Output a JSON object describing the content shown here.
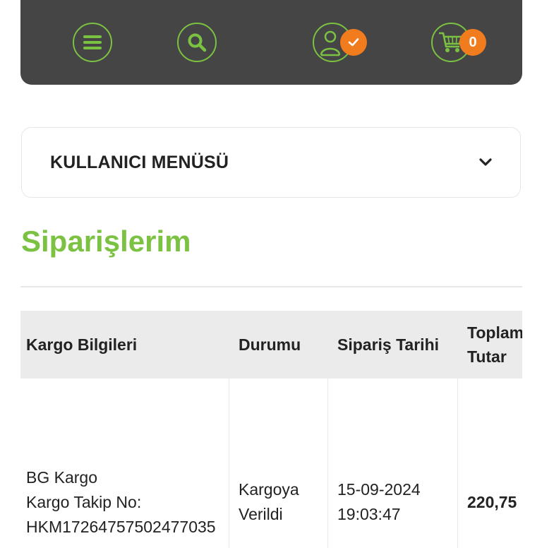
{
  "header": {
    "icons": [
      "menu-icon",
      "search-icon",
      "user-icon",
      "cart-icon"
    ],
    "user_badge_icon": "check-icon",
    "cart_count": "0",
    "colors": {
      "bar": "#454545",
      "accent": "#7cc242",
      "badge": "#f07c1e"
    }
  },
  "user_menu": {
    "title": "KULLANICI MENÜSÜ",
    "toggle_icon": "chevron-down-icon"
  },
  "page_title": "Siparişlerim",
  "orders_table": {
    "columns": [
      "Kargo Bilgileri",
      "Durumu",
      "Sipariş Tarihi",
      "Toplam Tutar"
    ],
    "rows": [
      {
        "cargo_company": "BG Kargo",
        "tracking_label": "Kargo Takip No:",
        "tracking_no": "HKM17264757502477035",
        "status": "Kargoya Verildi",
        "date": "15-09-2024",
        "time": "19:03:47",
        "total": "220,75"
      }
    ]
  }
}
